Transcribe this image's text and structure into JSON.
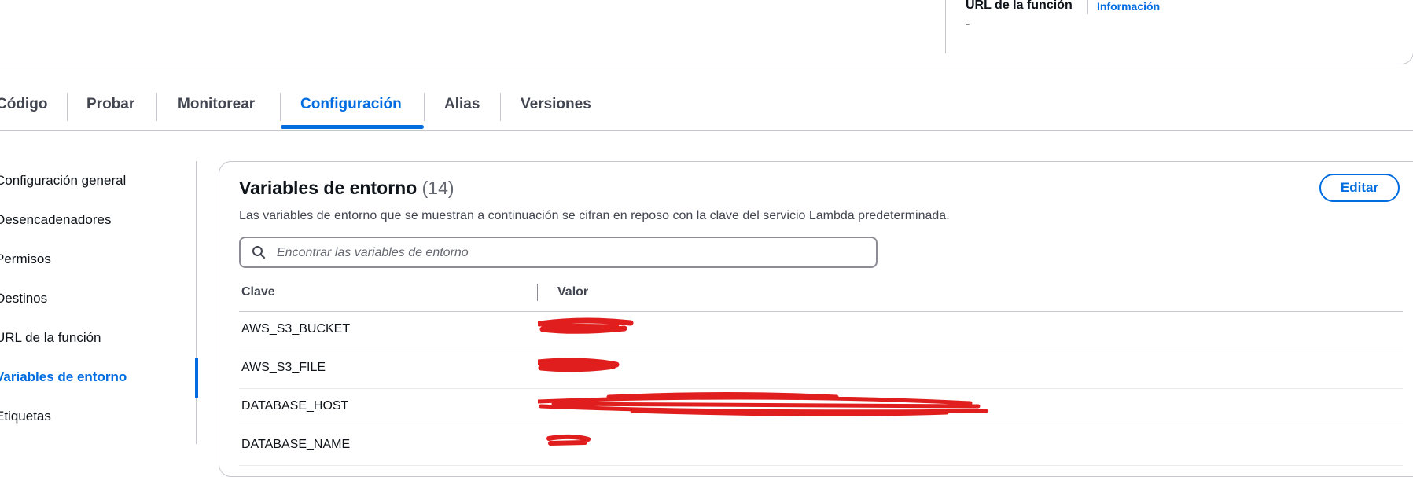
{
  "header": {
    "function_url_label": "URL de la función",
    "info_link": "Información",
    "function_url_value": "-"
  },
  "tabs": [
    {
      "label": "Código",
      "active": false
    },
    {
      "label": "Probar",
      "active": false
    },
    {
      "label": "Monitorear",
      "active": false
    },
    {
      "label": "Configuración",
      "active": true
    },
    {
      "label": "Alias",
      "active": false
    },
    {
      "label": "Versiones",
      "active": false
    }
  ],
  "sidebar": {
    "items": [
      {
        "label": "Configuración general",
        "active": false
      },
      {
        "label": "Desencadenadores",
        "active": false
      },
      {
        "label": "Permisos",
        "active": false
      },
      {
        "label": "Destinos",
        "active": false
      },
      {
        "label": "URL de la función",
        "active": false
      },
      {
        "label": "Variables de entorno",
        "active": true
      },
      {
        "label": "Etiquetas",
        "active": false
      }
    ]
  },
  "env": {
    "title": "Variables de entorno",
    "count": "(14)",
    "description": "Las variables de entorno que se muestran a continuación se cifran en reposo con la clave del servicio Lambda predeterminada.",
    "edit_label": "Editar",
    "search_placeholder": "Encontrar las variables de entorno",
    "columns": {
      "key": "Clave",
      "value": "Valor"
    },
    "rows": [
      {
        "key": "AWS_S3_BUCKET",
        "value_redacted": true
      },
      {
        "key": "AWS_S3_FILE",
        "value_redacted": true
      },
      {
        "key": "DATABASE_HOST",
        "value_redacted": true
      },
      {
        "key": "DATABASE_NAME",
        "value_redacted": true
      }
    ]
  },
  "colors": {
    "accent": "#006ce0",
    "redaction": "#e01e1e",
    "border": "#c6c6cd"
  }
}
